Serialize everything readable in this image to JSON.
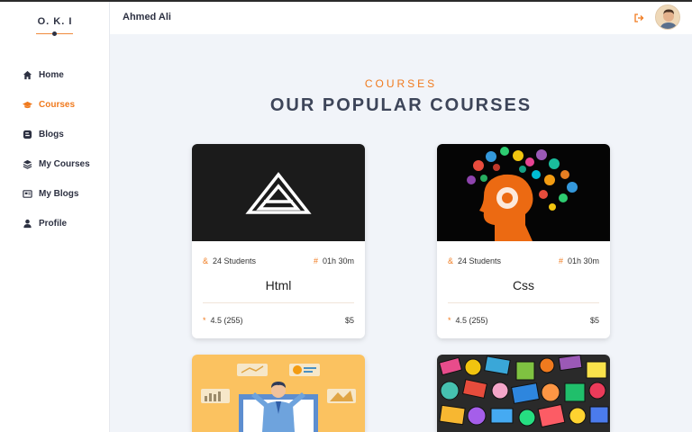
{
  "app": {
    "logo": "O. K. I"
  },
  "sidebar": {
    "items": [
      {
        "label": "Home",
        "icon": "home-icon"
      },
      {
        "label": "Courses",
        "icon": "graduation-cap-icon",
        "active": true
      },
      {
        "label": "Blogs",
        "icon": "blog-icon"
      },
      {
        "label": "My Courses",
        "icon": "layers-icon"
      },
      {
        "label": "My Blogs",
        "icon": "newspaper-icon"
      },
      {
        "label": "Profile",
        "icon": "user-icon"
      }
    ]
  },
  "header": {
    "user_name": "Ahmed Ali",
    "logout_icon": "logout-icon",
    "avatar_icon": "avatar-icon"
  },
  "section": {
    "subtitle": "COURSES",
    "title": "OUR POPULAR COURSES"
  },
  "colors": {
    "accent": "#f07a1e",
    "heading": "#3d4559",
    "background": "#f1f4f9"
  },
  "courses": [
    {
      "title": "Html",
      "students": "24 Students",
      "duration": "01h 30m",
      "rating": "4.5 (255)",
      "price": "$5",
      "image": "logo-a-image"
    },
    {
      "title": "Css",
      "students": "24 Students",
      "duration": "01h 30m",
      "rating": "4.5 (255)",
      "price": "$5",
      "image": "brain-icons-image"
    },
    {
      "image": "presenter-illustration-image"
    },
    {
      "image": "doodle-pattern-image"
    }
  ],
  "meta_icons": {
    "students": "&",
    "duration": "#",
    "rating": "*"
  }
}
